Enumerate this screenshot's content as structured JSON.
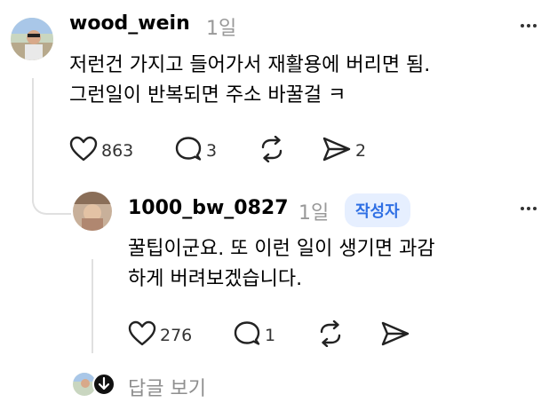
{
  "comment": {
    "username": "wood_wein",
    "time": "1일",
    "lines": [
      "저런건 가지고 들어가서 재활용에 버리면 됨.",
      "그런일이 반복되면 주소 바꿀걸 ㅋ"
    ],
    "likes": "863",
    "replies": "3",
    "shares": "2"
  },
  "reply": {
    "username": "1000_bw_0827",
    "time": "1일",
    "badge": "작성자",
    "lines": [
      "꿀팁이군요. 또 이런 일이 생기면 과감",
      "하게 버려보겠습니다."
    ],
    "likes": "276",
    "replies": "1"
  },
  "view_replies_label": "답글 보기",
  "colors": {
    "badge_bg": "#e6efff",
    "badge_text": "#2f6fe4",
    "muted": "#999999"
  }
}
